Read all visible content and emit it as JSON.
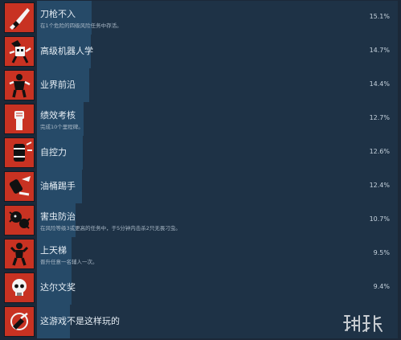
{
  "achievements": [
    {
      "title": "刀枪不入",
      "desc": "在1个危险的四级风险任务中存活。",
      "percent": "15.1%",
      "fill": 0.151,
      "icon": "knife-hand-icon"
    },
    {
      "title": "高级机器人学",
      "desc": "",
      "percent": "14.7%",
      "fill": 0.147,
      "icon": "robot-head-icon"
    },
    {
      "title": "业界前沿",
      "desc": "",
      "percent": "14.4%",
      "fill": 0.144,
      "icon": "armored-figure-icon"
    },
    {
      "title": "绩效考核",
      "desc": "完成10个里程碑。",
      "percent": "12.7%",
      "fill": 0.127,
      "icon": "raised-fist-icon"
    },
    {
      "title": "自控力",
      "desc": "",
      "percent": "12.6%",
      "fill": 0.126,
      "icon": "barrel-icon"
    },
    {
      "title": "油桶踢手",
      "desc": "",
      "percent": "12.4%",
      "fill": 0.124,
      "icon": "kicking-barrel-icon"
    },
    {
      "title": "害虫防治",
      "desc": "在风险等级3或更高的任务中，于5分钟内击杀2只无畏刁虫。",
      "percent": "10.7%",
      "fill": 0.107,
      "icon": "bug-swarm-icon"
    },
    {
      "title": "上天梯",
      "desc": "晋升任意一名辅人一次。",
      "percent": "9.5%",
      "fill": 0.095,
      "icon": "rising-figure-icon"
    },
    {
      "title": "达尔文奖",
      "desc": "",
      "percent": "9.4%",
      "fill": 0.094,
      "icon": "skull-icon"
    },
    {
      "title": "这游戏不是这样玩的",
      "desc": "",
      "percent": "",
      "fill": 0.09,
      "icon": "pointing-hand-icon"
    }
  ],
  "colors": {
    "icon_bg": "#c83222",
    "bar": "#264a68",
    "background": "#1b2838"
  }
}
